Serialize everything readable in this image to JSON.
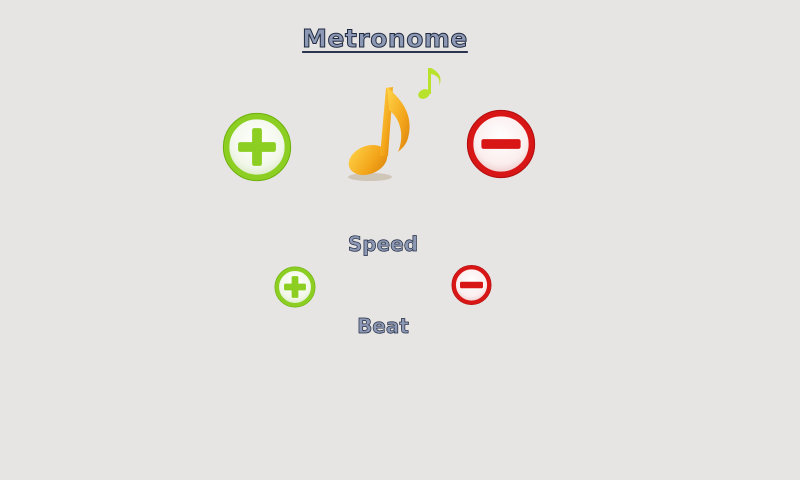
{
  "app": {
    "title": "Metronome"
  },
  "controls": {
    "speed_label": "Speed",
    "beat_label": "Beat"
  },
  "icons": {
    "title_note": "music-note-icon",
    "increase": "plus-icon",
    "decrease": "minus-icon"
  },
  "colors": {
    "background": "#e7e4e4",
    "plus_green": "#8ccf22",
    "minus_red": "#d81616",
    "note_orange": "#f2a51c",
    "note_green": "#b8e22b",
    "text_fill": "#8d98b4",
    "text_outline": "#1f2a40"
  }
}
